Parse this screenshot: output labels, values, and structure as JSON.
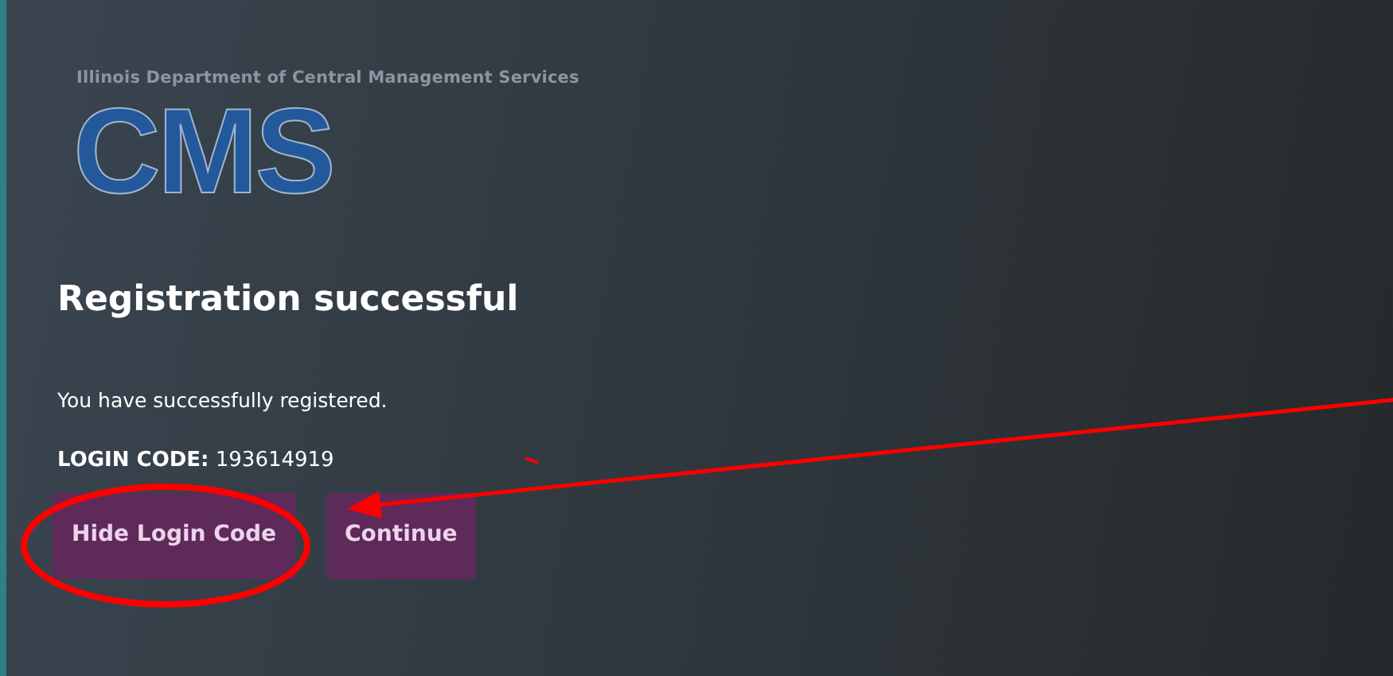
{
  "agency": "Illinois Department of Central Management Services",
  "logo": "CMS",
  "heading": "Registration successful",
  "message": "You have successfully registered.",
  "login_code": {
    "label": "LOGIN CODE:",
    "value": "193614919"
  },
  "buttons": [
    {
      "label": "Hide Login Code"
    },
    {
      "label": "Continue"
    }
  ],
  "annotations": [
    {
      "kind": "circle"
    },
    {
      "kind": "arrow"
    },
    {
      "kind": "tick"
    }
  ]
}
